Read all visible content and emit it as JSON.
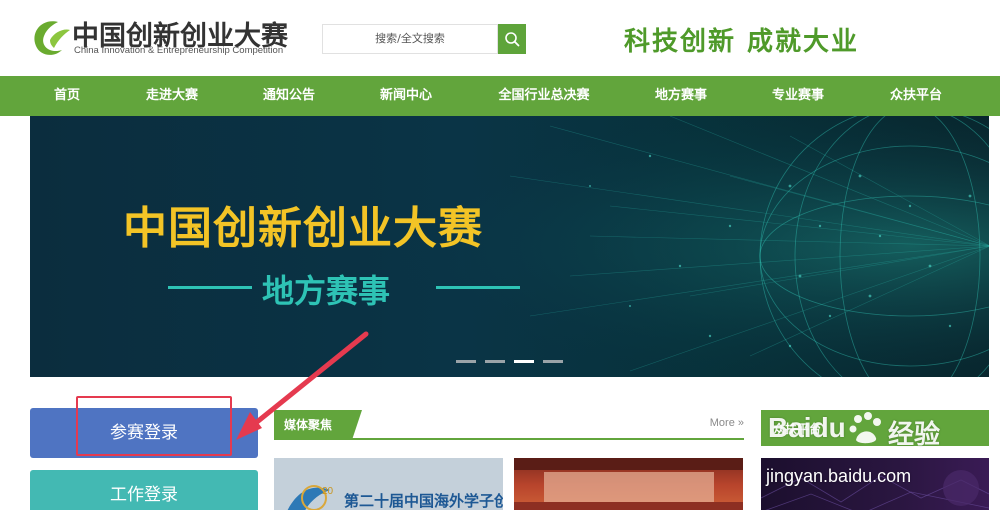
{
  "header": {
    "logo_cn": "中国创新创业大赛",
    "logo_en": "China Innovation & Entrepreneurship  Competition",
    "search_placeholder": "搜索/全文搜索",
    "slogan": "科技创新  成就大业"
  },
  "nav": {
    "items": [
      {
        "label": "首页"
      },
      {
        "label": "走进大赛"
      },
      {
        "label": "通知公告"
      },
      {
        "label": "新闻中心"
      },
      {
        "label": "全国行业总决赛"
      },
      {
        "label": "地方赛事"
      },
      {
        "label": "专业赛事"
      },
      {
        "label": "众扶平台"
      }
    ]
  },
  "banner": {
    "title": "中国创新创业大赛",
    "subtitle": "地方赛事",
    "slides_total": 4,
    "active_slide": 3
  },
  "sidebar": {
    "login_label": "参赛登录",
    "work_label": "工作登录"
  },
  "media": {
    "tab_label": "媒体聚焦",
    "more_label": "More »",
    "thumb1_number": "20",
    "thumb1_text": "第二十届中国海外学子创业周"
  },
  "zhongfu": {
    "title": "众扶平台"
  },
  "watermark": {
    "brand": "Baidu",
    "product": "经验",
    "url": "jingyan.baidu.com"
  },
  "colors": {
    "brand_green": "#62a53c",
    "login_blue": "#4f74c2",
    "work_teal": "#43b9b3",
    "banner_title_yellow": "#f3c426",
    "banner_sub_teal": "#2ec3b5",
    "annotation_red": "#e53a4f"
  }
}
